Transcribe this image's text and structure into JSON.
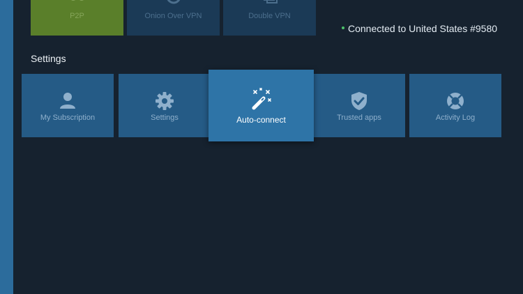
{
  "top_row": {
    "items": [
      {
        "label": "P2P",
        "icon": "p2p-icon"
      },
      {
        "label": "Onion Over VPN",
        "icon": "onion-icon"
      },
      {
        "label": "Double VPN",
        "icon": "double-vpn-icon"
      }
    ]
  },
  "status": {
    "text": "Connected to United States #9580",
    "indicator_color": "#4cc36b"
  },
  "settings": {
    "title": "Settings",
    "tiles": [
      {
        "label": "My Subscription",
        "icon": "user-icon"
      },
      {
        "label": "Settings",
        "icon": "gear-icon"
      },
      {
        "label": "Auto-connect",
        "icon": "magic-wand-icon",
        "focused": true
      },
      {
        "label": "Trusted apps",
        "icon": "shield-check-icon"
      },
      {
        "label": "Activity Log",
        "icon": "lifebuoy-icon"
      }
    ]
  },
  "colors": {
    "background": "#16222f",
    "tile": "#255b86",
    "tile_focused": "#2e74a7",
    "p2p_tile": "#5a7f2a",
    "side_strip": "#2c6c9c"
  }
}
